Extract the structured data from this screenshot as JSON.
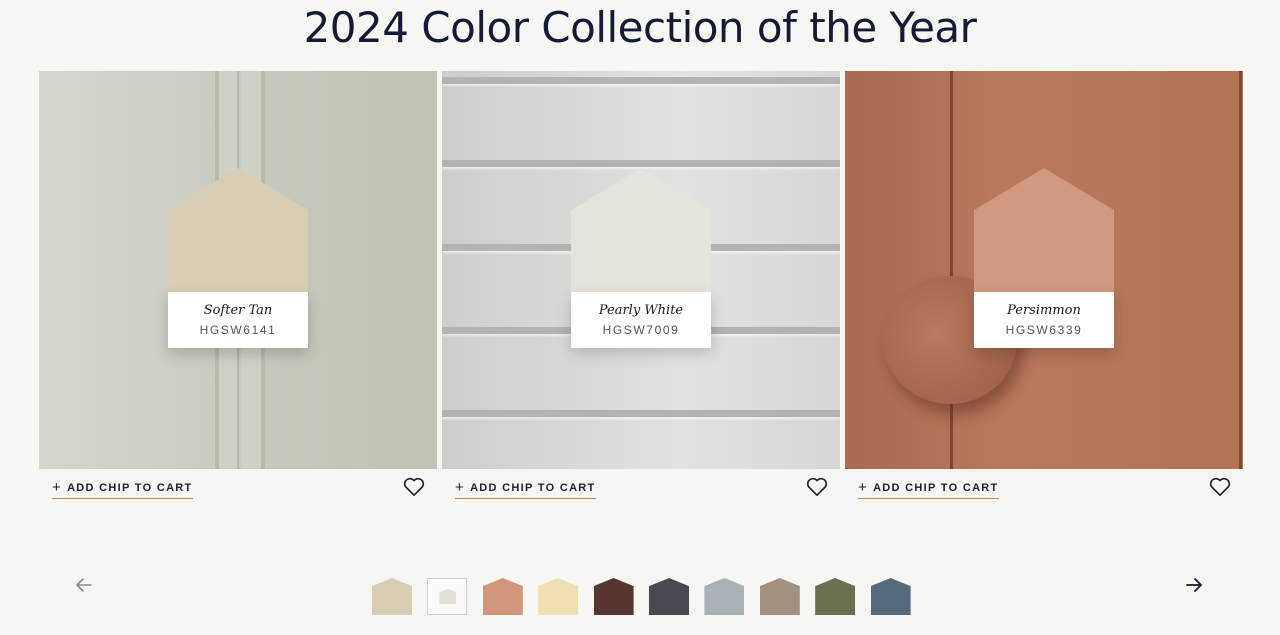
{
  "page": {
    "title": "2024 Color Collection of the Year"
  },
  "cards": [
    {
      "name": "Softer Tan",
      "code": "HGSW6141",
      "color": "#d8ccb4",
      "add_label": "ADD CHIP TO CART"
    },
    {
      "name": "Pearly White",
      "code": "HGSW7009",
      "color": "#e6e2dc",
      "add_label": "ADD CHIP TO CART"
    },
    {
      "name": "Persimmon",
      "code": "HGSW6339",
      "color": "#d19a80",
      "add_label": "ADD CHIP TO CART"
    }
  ],
  "icons": {
    "prev": "arrow-left-icon",
    "next": "arrow-right-icon",
    "favorite": "heart-icon",
    "add": "plus-icon"
  },
  "swatches": [
    {
      "color": "#d9ccb5"
    },
    {
      "color": "#e4e0d9"
    },
    {
      "color": "#d0977c"
    },
    {
      "color": "#f0dfb0"
    },
    {
      "color": "#563631"
    },
    {
      "color": "#474b51"
    },
    {
      "color": "#a7b3b7"
    },
    {
      "color": "#a39180"
    },
    {
      "color": "#6b7150"
    },
    {
      "color": "#556a7c"
    }
  ],
  "carousel": {
    "active_index": 1
  }
}
